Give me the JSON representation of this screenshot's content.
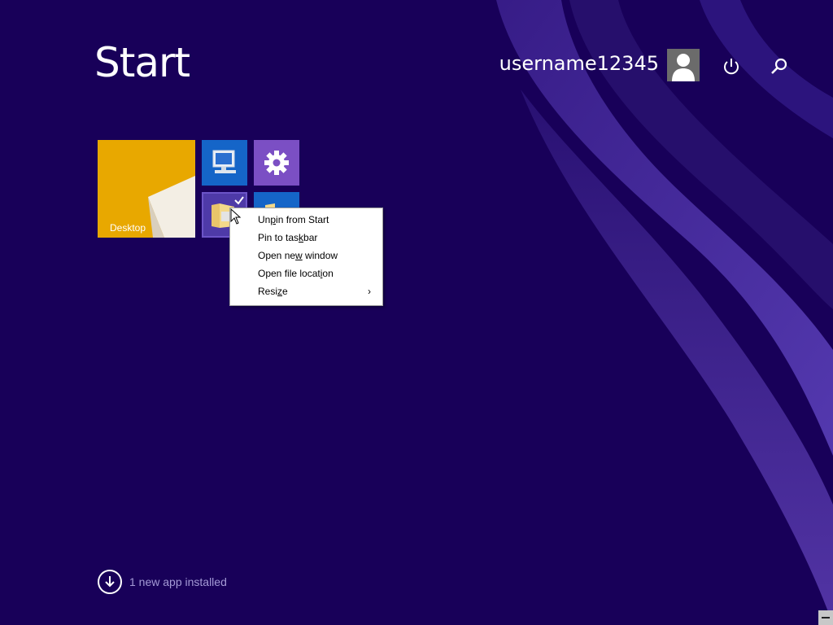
{
  "header": {
    "title": "Start",
    "username": "username12345"
  },
  "icons": {
    "power": "power-icon",
    "search": "search-icon",
    "avatar": "user-avatar-icon"
  },
  "tiles": [
    {
      "name": "Desktop",
      "label": "Desktop",
      "color": "#e8a800"
    },
    {
      "name": "This PC",
      "icon": "computer-icon",
      "color": "#1565c8"
    },
    {
      "name": "PC settings",
      "icon": "gear-icon",
      "color": "#7b4fc4"
    },
    {
      "name": "File Explorer",
      "icon": "folder-icon",
      "color": "#4e3aa8",
      "selected": true
    },
    {
      "name": "Folder",
      "icon": "folder-icon",
      "color": "#1565c8"
    }
  ],
  "context_menu": {
    "items": [
      {
        "label": "Unpin from Start",
        "pre": "Un",
        "key": "p",
        "post": "in from Start"
      },
      {
        "label": "Pin to taskbar",
        "pre": "Pin to tas",
        "key": "k",
        "post": "bar"
      },
      {
        "label": "Open new window",
        "pre": "Open ne",
        "key": "w",
        "post": " window"
      },
      {
        "label": "Open file location",
        "pre": "Open file locat",
        "key": "i",
        "post": "on"
      },
      {
        "label": "Resize",
        "pre": "Resi",
        "key": "z",
        "post": "e",
        "submenu_arrow": "›"
      }
    ]
  },
  "notification": {
    "text": "1 new app installed",
    "icon": "download-arrow-icon"
  },
  "colors": {
    "background": "#180059",
    "accent_swirl": "#4a2fa0"
  }
}
